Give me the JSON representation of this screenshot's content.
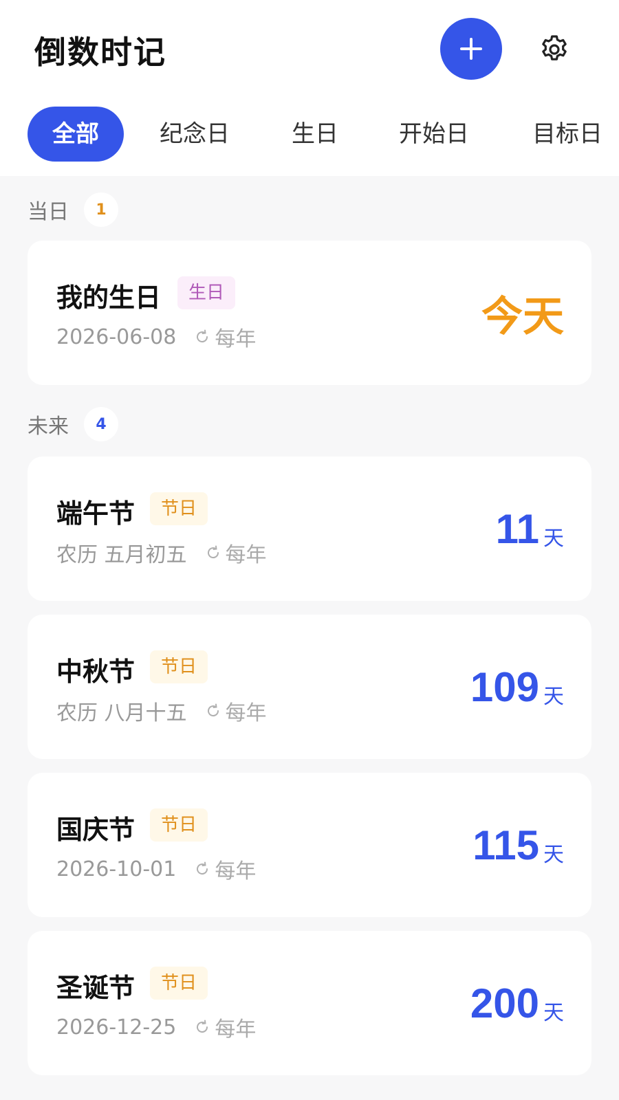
{
  "header": {
    "title": "倒数时记",
    "add_icon": "plus-icon",
    "settings_icon": "gear-icon",
    "accent_color": "#3555e8"
  },
  "tabs": [
    {
      "label": "全部",
      "active": true
    },
    {
      "label": "纪念日",
      "active": false
    },
    {
      "label": "生日",
      "active": false
    },
    {
      "label": "开始日",
      "active": false
    },
    {
      "label": "目标日",
      "active": false
    }
  ],
  "sections": {
    "today": {
      "label": "当日",
      "count": "1",
      "count_color": "#e0901c",
      "items": [
        {
          "title": "我的生日",
          "tag": "生日",
          "date": "2026-06-08",
          "repeat": "每年",
          "countdown": "今天"
        }
      ]
    },
    "future": {
      "label": "未来",
      "count": "4",
      "count_color": "#3555e8",
      "items": [
        {
          "title": "端午节",
          "tag": "节日",
          "date": "农历 五月初五",
          "repeat": "每年",
          "days": "11",
          "unit": "天"
        },
        {
          "title": "中秋节",
          "tag": "节日",
          "date": "农历 八月十五",
          "repeat": "每年",
          "days": "109",
          "unit": "天"
        },
        {
          "title": "国庆节",
          "tag": "节日",
          "date": "2026-10-01",
          "repeat": "每年",
          "days": "115",
          "unit": "天"
        },
        {
          "title": "圣诞节",
          "tag": "节日",
          "date": "2026-12-25",
          "repeat": "每年",
          "days": "200",
          "unit": "天"
        }
      ]
    }
  }
}
